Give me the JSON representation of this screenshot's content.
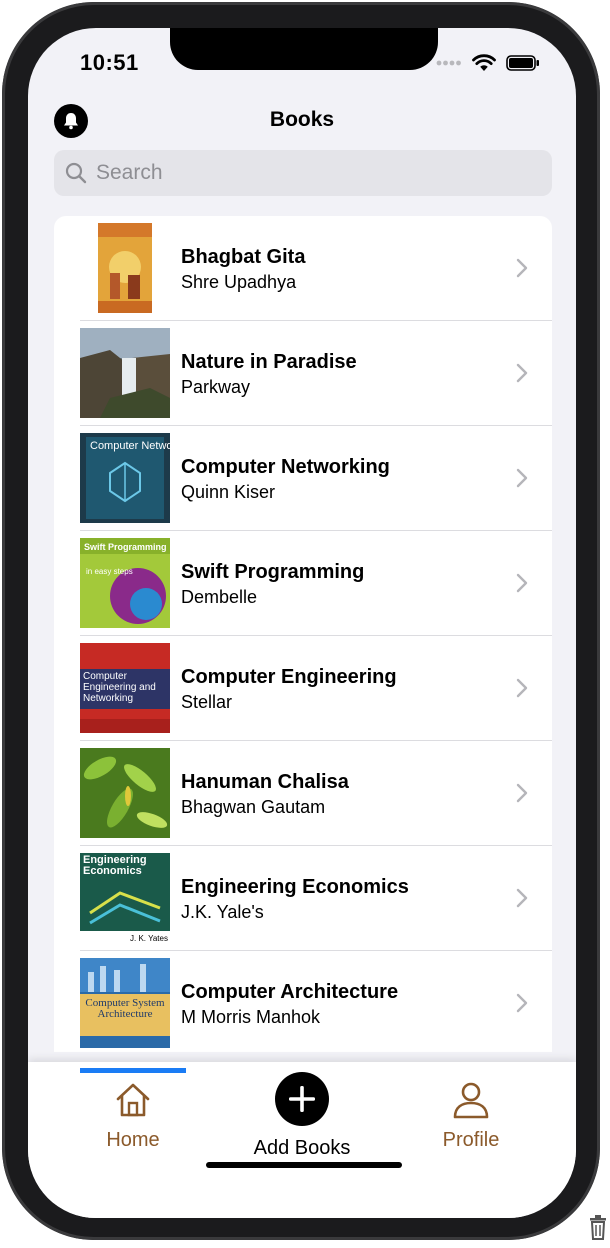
{
  "status_bar": {
    "time": "10:51"
  },
  "nav": {
    "title": "Books",
    "left_icon": "bell-icon"
  },
  "search": {
    "placeholder": "Search",
    "value": ""
  },
  "books": [
    {
      "title": "Bhagbat Gita",
      "author": "Shre Upadhya"
    },
    {
      "title": "Nature in Paradise",
      "author": "Parkway"
    },
    {
      "title": "Computer Networking",
      "author": "Quinn Kiser"
    },
    {
      "title": "Swift Programming",
      "author": "Dembelle"
    },
    {
      "title": "Computer Engineering",
      "author": "Stellar"
    },
    {
      "title": "Hanuman Chalisa",
      "author": "Bhagwan Gautam"
    },
    {
      "title": "Engineering Economics",
      "author": "J.K. Yale's"
    },
    {
      "title": "Computer Architecture",
      "author": "M Morris Manhok"
    }
  ],
  "covers": {
    "networking_text": "Computer Networking",
    "swift_text": "Swift Programming",
    "swift_sub": "in easy steps",
    "engineering_text": "Computer Engineering and Networking",
    "economics_text": "Engineering Economics",
    "economics_author": "J. K. Yates",
    "architecture_text": "Computer System Architecture"
  },
  "tabbar": {
    "home": "Home",
    "add": "Add Books",
    "profile": "Profile",
    "accent_color": "#8b5a2b",
    "indicator_color": "#1a7cf5"
  }
}
